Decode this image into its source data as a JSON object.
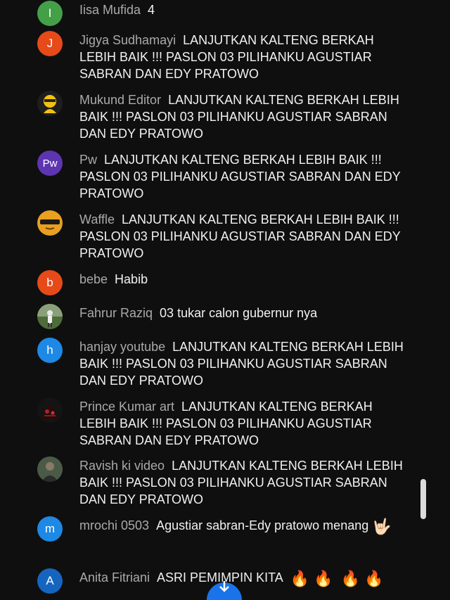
{
  "messages": [
    {
      "author": "Iisa Mufida",
      "text": "4",
      "avatar_letter": "I",
      "avatar_color": "#43a047"
    },
    {
      "author": "Jigya Sudhamayi",
      "text": "LANJUTKAN KALTENG BERKAH LEBIH BAIK !!! PASLON 03 PILIHANKU AGUSTIAR SABRAN DAN EDY PRATOWO",
      "avatar_letter": "J",
      "avatar_color": "#e64a19"
    },
    {
      "author": "Mukund Editor",
      "text": "LANJUTKAN KALTENG BERKAH LEBIH BAIK !!! PASLON 03 PILIHANKU AGUSTIAR SABRAN DAN EDY PRATOWO",
      "avatar_letter": "",
      "avatar_color": "#1e1e1e"
    },
    {
      "author": "Pw",
      "text": "LANJUTKAN KALTENG BERKAH LEBIH BAIK !!! PASLON 03 PILIHANKU AGUSTIAR SABRAN DAN EDY PRATOWO",
      "avatar_letter": "Pw",
      "avatar_color": "#5e35b1"
    },
    {
      "author": "Waffle",
      "text": "LANJUTKAN KALTENG BERKAH LEBIH BAIK !!! PASLON 03 PILIHANKU AGUSTIAR SABRAN DAN EDY PRATOWO",
      "avatar_letter": "",
      "avatar_color": "#e8a020"
    },
    {
      "author": "bebe",
      "text": "Habib",
      "avatar_letter": "b",
      "avatar_color": "#e64a19"
    },
    {
      "author": "Fahrur Raziq",
      "text": "03 tukar calon gubernur nya",
      "avatar_letter": "",
      "avatar_color": "#4e6b3a"
    },
    {
      "author": "hanjay youtube",
      "text": "LANJUTKAN KALTENG BERKAH LEBIH BAIK !!! PASLON 03 PILIHANKU AGUSTIAR SABRAN DAN EDY PRATOWO",
      "avatar_letter": "h",
      "avatar_color": "#1e88e5"
    },
    {
      "author": "Prince Kumar art",
      "text": "LANJUTKAN KALTENG BERKAH LEBIH BAIK !!! PASLON 03 PILIHANKU AGUSTIAR SABRAN DAN EDY PRATOWO",
      "avatar_letter": "",
      "avatar_color": "#141414"
    },
    {
      "author": "Ravish ki video",
      "text": "LANJUTKAN KALTENG BERKAH LEBIH BAIK !!! PASLON 03 PILIHANKU AGUSTIAR SABRAN DAN EDY PRATOWO",
      "avatar_letter": "",
      "avatar_color": "#3d4a3a"
    },
    {
      "author": "mrochi 0503",
      "text": "Agustiar sabran-Edy pratowo menang",
      "avatar_letter": "m",
      "avatar_color": "#1e88e5"
    },
    {
      "author": "Anita Fitriani",
      "text": "ASRI PEMIMPIN KITA",
      "avatar_letter": "A",
      "avatar_color": "#1565c0"
    }
  ],
  "icons": {
    "mukund": "cartoon-character-icon",
    "waffle": "sunglasses-face-icon",
    "fahrur": "person-photo-icon",
    "prince": "dark-art-icon",
    "ravish": "person-photo-icon",
    "rock_hand": "rock-on-hand-emoji",
    "fire": "fire-emoji",
    "scroll_down": "arrow-down-icon"
  },
  "emojis": {
    "rock_hand": "🤟🏻",
    "fire": "🔥"
  },
  "colors": {
    "background": "#0f0f0f",
    "author": "#aaaaaa",
    "message": "#f1f1f1",
    "scroll_button": "#1a73e8",
    "scrollbar_thumb": "#dcdcdc"
  }
}
